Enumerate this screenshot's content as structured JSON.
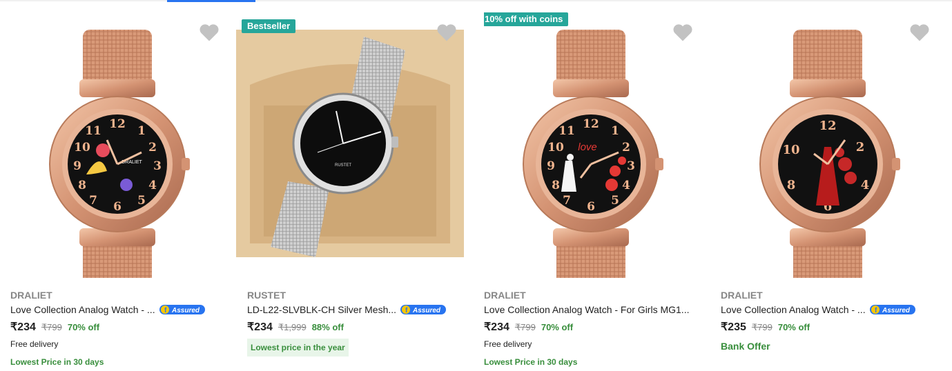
{
  "products": [
    {
      "brand": "DRALIET",
      "title": "Love Collection Analog Watch - ...",
      "assured": "Assured",
      "price": "₹234",
      "mrp": "₹799",
      "discount": "70% off",
      "delivery": "Free delivery",
      "offer": "Lowest Price in 30 days",
      "badge": null
    },
    {
      "brand": "RUSTET",
      "title": "LD-L22-SLVBLK-CH Silver Mesh...",
      "assured": "Assured",
      "price": "₹234",
      "mrp": "₹1,999",
      "discount": "88% off",
      "offer": "Lowest price in the year",
      "badge": "Bestseller"
    },
    {
      "brand": "DRALIET",
      "title": "Love Collection Analog Watch - For Girls MG1...",
      "assured": null,
      "price": "₹234",
      "mrp": "₹799",
      "discount": "70% off",
      "delivery": "Free delivery",
      "offer": "Lowest Price in 30 days",
      "badge": "10% off with coins"
    },
    {
      "brand": "DRALIET",
      "title": "Love Collection Analog Watch - ...",
      "assured": "Assured",
      "price": "₹235",
      "mrp": "₹799",
      "discount": "70% off",
      "offer": "Bank Offer",
      "badge": null
    }
  ],
  "watch_labels": {
    "dial_brand_1": "DRALIET",
    "dial_brand_2": "RUSTET",
    "love_text": "love"
  },
  "colors": {
    "accent": "#2874f0",
    "badge": "#26a69a",
    "green": "#388e3c",
    "rose_gold": "#d9a07d"
  },
  "icons": [
    "wishlist-heart-icon",
    "assured-badge-icon"
  ]
}
